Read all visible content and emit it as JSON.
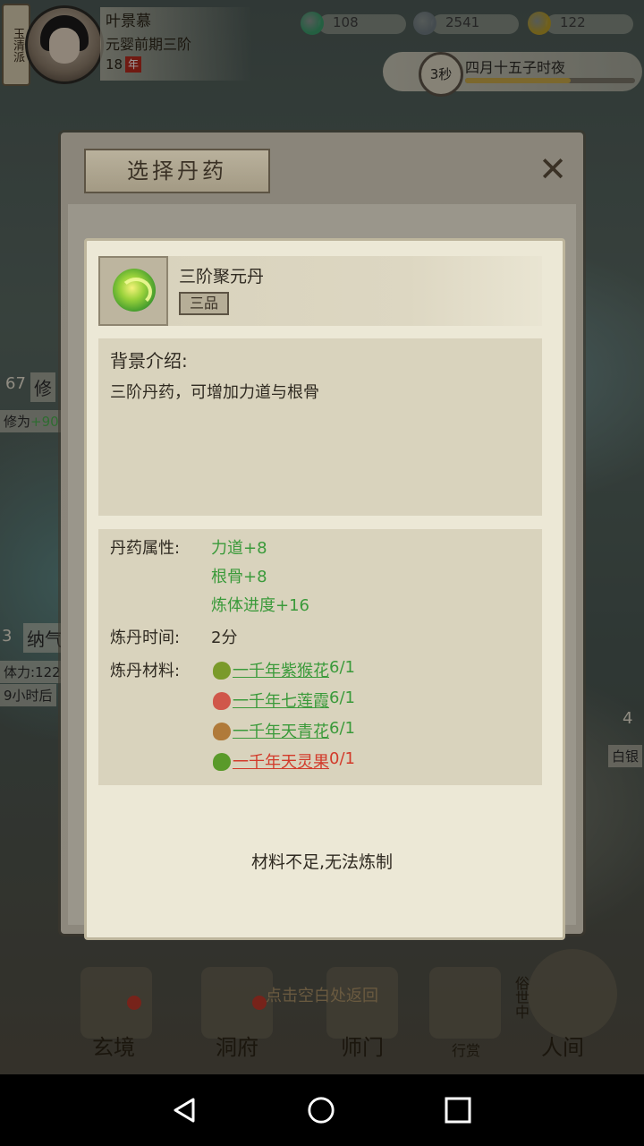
{
  "player": {
    "sect": "玉清派",
    "name": "叶景慕",
    "realm": "元婴前期三阶",
    "age": "18",
    "age_badge": "年"
  },
  "resources": [
    {
      "icon": "spirit-stone-icon",
      "value": "108",
      "color": "#3a9a6a"
    },
    {
      "icon": "coin-icon",
      "value": "2541",
      "color": "#6f7a80"
    },
    {
      "icon": "ingot-icon",
      "value": "122",
      "color": "#b59a2a"
    }
  ],
  "timer": {
    "seconds": "3秒",
    "date": "四月十五子时夜",
    "progress": 0.62
  },
  "side": {
    "left_level": "67",
    "left_title": "修",
    "left_cultivation_prefix": "修为",
    "left_cultivation_value": "+90",
    "left_num2": "3",
    "left_title2": "纳气",
    "left_stamina": "体力:122/",
    "left_time": "9小时后",
    "right_num": "4",
    "right_label": "白银"
  },
  "dialog": {
    "title": "选择丹药",
    "close": "✕",
    "pill": {
      "name": "三阶聚元丹",
      "grade": "三品"
    },
    "background": {
      "label": "背景介绍:",
      "text": "三阶丹药，可增加力道与根骨"
    },
    "attributes": {
      "label": "丹药属性:",
      "items": [
        "力道+8",
        "根骨+8",
        "炼体进度+16"
      ]
    },
    "time": {
      "label": "炼丹时间:",
      "value": "2分"
    },
    "materials": {
      "label": "炼丹材料:",
      "items": [
        {
          "name": "一千年紫猴花",
          "count": "6/1",
          "enough": true,
          "icon_color": "#7a9a2a"
        },
        {
          "name": "一千年七莲霞",
          "count": "6/1",
          "enough": true,
          "icon_color": "#d0574a"
        },
        {
          "name": "一千年天青花",
          "count": "6/1",
          "enough": true,
          "icon_color": "#b07a3a"
        },
        {
          "name": "一千年天灵果",
          "count": "0/1",
          "enough": false,
          "icon_color": "#5a9a2a"
        }
      ]
    },
    "status": "材料不足,无法炼制"
  },
  "bottom": {
    "hint": "点击空白处返回",
    "nav": [
      "玄境",
      "洞府",
      "师门",
      "行赏",
      "人间"
    ],
    "side_vertical": "俗世中"
  }
}
